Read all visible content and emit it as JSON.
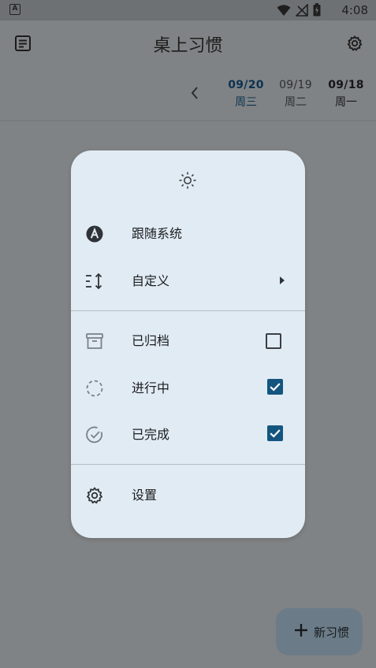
{
  "status_bar": {
    "left_icon_letter": "A",
    "time": "4:08"
  },
  "app_bar": {
    "title": "桌上习惯"
  },
  "dates": [
    {
      "date": "09/20",
      "weekday": "周三"
    },
    {
      "date": "09/19",
      "weekday": "周二"
    },
    {
      "date": "09/18",
      "weekday": "周一"
    }
  ],
  "menu": {
    "theme_items": [
      {
        "label": "跟随系统",
        "icon": "auto-theme-icon"
      },
      {
        "label": "自定义",
        "icon": "sort-icon"
      }
    ],
    "filter_items": [
      {
        "label": "已归档",
        "icon": "archive-icon",
        "checked": false
      },
      {
        "label": "进行中",
        "icon": "in-progress-icon",
        "checked": true
      },
      {
        "label": "已完成",
        "icon": "completed-icon",
        "checked": true
      }
    ],
    "settings_label": "设置"
  },
  "fab": {
    "label": "新习惯"
  },
  "colors": {
    "accent": "#14557f",
    "popup_bg": "#e1ebf4",
    "scrim": "#808385"
  }
}
